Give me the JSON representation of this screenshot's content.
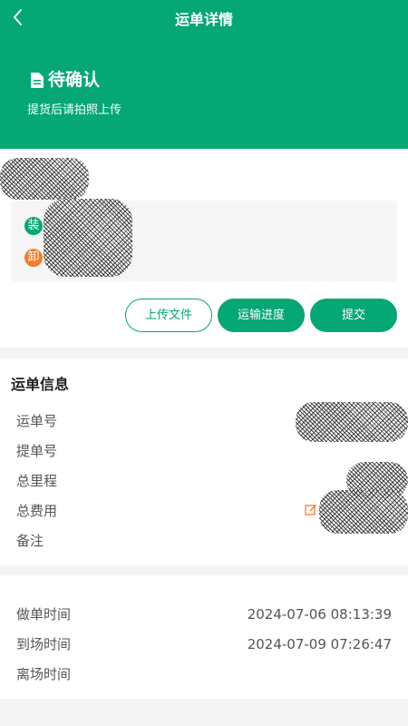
{
  "nav": {
    "title": "运单详情",
    "back_icon": "chevron-left-icon"
  },
  "status": {
    "title": "待确认",
    "subtitle": "提货后请拍照上传",
    "icon": "document-icon"
  },
  "route": {
    "load_badge": "装",
    "unload_badge": "卸"
  },
  "actions": {
    "upload_label": "上传文件",
    "progress_label": "运输进度",
    "submit_label": "提交"
  },
  "waybill_info": {
    "title": "运单信息",
    "labels": {
      "waybill_no": "运单号",
      "bill_no": "提单号",
      "mileage": "总里程",
      "total_fee": "总费用",
      "remark": "备注"
    }
  },
  "times": [
    {
      "label": "做单时间",
      "value": "2024-07-06 08:13:39"
    },
    {
      "label": "到场时间",
      "value": "2024-07-09 07:26:47"
    },
    {
      "label": "离场时间",
      "value": ""
    }
  ],
  "colors": {
    "primary": "#05a774",
    "unload": "#f07e2c",
    "edit": "#f07e2c"
  }
}
